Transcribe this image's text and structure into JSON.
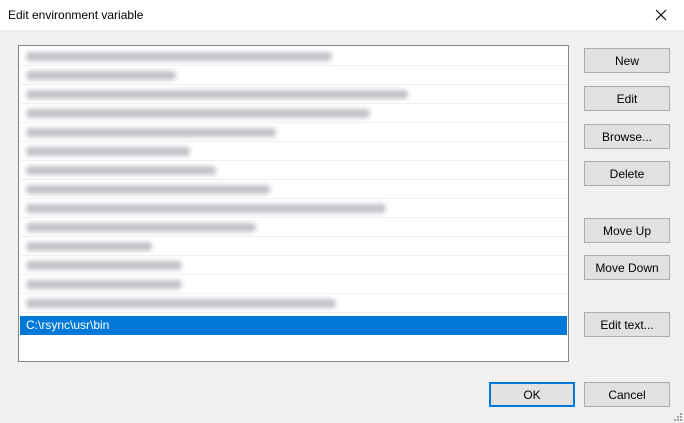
{
  "window": {
    "title": "Edit environment variable",
    "close_icon": "close-icon"
  },
  "path_list": {
    "entries": [
      {
        "obscured": true
      },
      {
        "obscured": true
      },
      {
        "obscured": true
      },
      {
        "obscured": true
      },
      {
        "obscured": true
      },
      {
        "obscured": true
      },
      {
        "obscured": true
      },
      {
        "obscured": true
      },
      {
        "obscured": true
      },
      {
        "obscured": true
      },
      {
        "obscured": true
      },
      {
        "obscured": true
      },
      {
        "obscured": true
      },
      {
        "obscured": true
      },
      {
        "text": "C:\\rsync\\usr\\bin",
        "selected": true
      }
    ],
    "selection_color": "#0078d7"
  },
  "side_buttons": {
    "new": "New",
    "edit": "Edit",
    "browse": "Browse...",
    "delete": "Delete",
    "move_up": "Move Up",
    "move_down": "Move Down",
    "edit_text": "Edit text..."
  },
  "footer": {
    "ok": "OK",
    "cancel": "Cancel"
  }
}
